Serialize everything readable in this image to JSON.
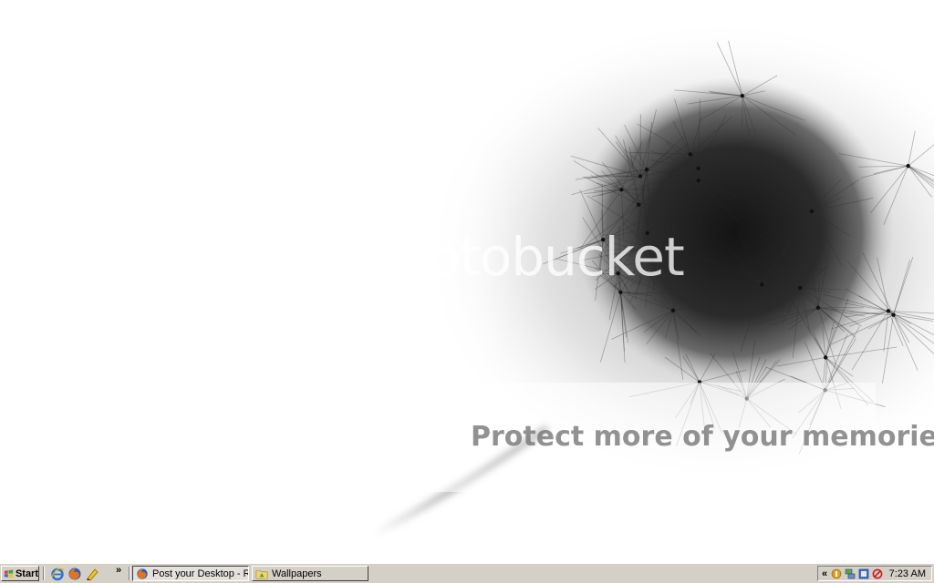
{
  "wallpaper": {
    "watermark": "photobucket",
    "tagline": "Protect more of your memories for less!"
  },
  "taskbar": {
    "start_label": "Start",
    "quick_launch": [
      {
        "icon": "ie-icon"
      },
      {
        "icon": "firefox-icon"
      },
      {
        "icon": "pencil-icon"
      }
    ],
    "quick_launch_chevron": "»",
    "tasks": [
      {
        "label": "Post your Desktop - RMR...",
        "icon": "firefox-icon",
        "active": true
      },
      {
        "label": "Wallpapers",
        "icon": "folder-icon",
        "active": false
      }
    ],
    "tray_chevron": "«",
    "tray_icons": [
      "shield-icon",
      "network-icon",
      "speaker-icon",
      "blocked-icon"
    ],
    "clock": "7:23 AM"
  }
}
